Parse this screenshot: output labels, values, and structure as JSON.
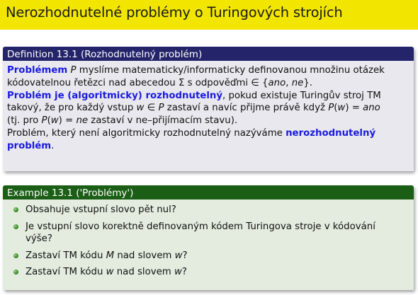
{
  "title": "Nerozhodnutelné problémy o Turingových strojích",
  "definition": {
    "heading": "Definition 13.1 (Rozhodnutelný problém)",
    "l1_a": "Problémem",
    "l1_b": " P",
    "l1_c": " myslíme matematicky/informaticky definovanou množinu otázek",
    "l2_a": "kódovatelnou řetězci nad abecedou Σ s odpověďmi ∈ {",
    "l2_b": "ano",
    "l2_c": ", ",
    "l2_d": "ne",
    "l2_e": "}.",
    "l3_a": "Problém je (algoritmicky) rozhodnutelný",
    "l3_b": ", pokud existuje Turingův stroj TM",
    "l4_a": "takový, že pro každý vstup ",
    "l4_b": "w",
    "l4_c": " ∈ ",
    "l4_d": "P",
    "l4_e": " zastaví a navíc přijme právě když ",
    "l4_f": "P",
    "l4_g": "(",
    "l4_h": "w",
    "l4_i": ") = ",
    "l4_j": "ano",
    "l5_a": "(tj. pro ",
    "l5_b": "P",
    "l5_c": "(",
    "l5_d": "w",
    "l5_e": ") = ",
    "l5_f": "ne",
    "l5_g": " zastaví v ne–přijímacím stavu).",
    "l6_a": "Problém, který není algoritmicky rozhodnutelný nazýváme ",
    "l6_b": "nerozhodnutelný",
    "l7_a": "problém",
    "l7_b": "."
  },
  "example": {
    "heading": "Example 13.1 ('Problémy')",
    "b1": "Obsahuje vstupní slovo pět nul?",
    "b2_a": "Je vstupní slovo korektně definovaným kódem Turingova stroje v kódování",
    "b2_b": "výše?",
    "b3_a": "Zastaví TM kódu ",
    "b3_b": "M",
    "b3_c": " nad slovem ",
    "b3_d": "w",
    "b3_e": "?",
    "b4_a": "Zastaví TM kódu ",
    "b4_b": "w",
    "b4_c": " nad slovem ",
    "b4_d": "w",
    "b4_e": "?"
  }
}
